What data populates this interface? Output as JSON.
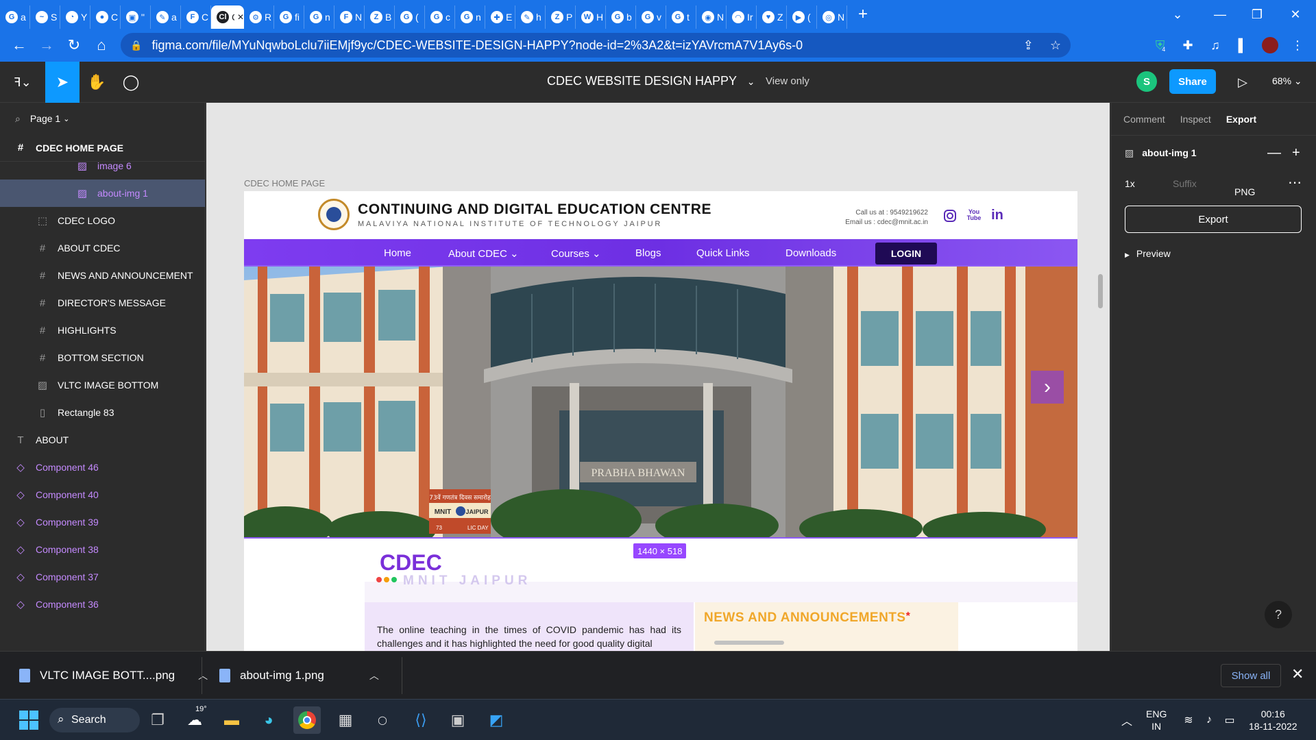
{
  "browser": {
    "tabs": [
      {
        "icon": "G",
        "text": "a"
      },
      {
        "icon": "~",
        "text": "S"
      },
      {
        "icon": "◔",
        "text": "Y"
      },
      {
        "icon": "●",
        "text": "C"
      },
      {
        "icon": "▣",
        "text": "\""
      },
      {
        "icon": "✎",
        "text": "a"
      },
      {
        "icon": "F",
        "text": "C"
      },
      {
        "icon": "Cl",
        "text": "Cl",
        "active": true
      },
      {
        "icon": "⚙",
        "text": "R"
      },
      {
        "icon": "G",
        "text": "fi"
      },
      {
        "icon": "G",
        "text": "n"
      },
      {
        "icon": "F",
        "text": "N"
      },
      {
        "icon": "Z",
        "text": "B"
      },
      {
        "icon": "G",
        "text": "("
      },
      {
        "icon": "G",
        "text": "c"
      },
      {
        "icon": "G",
        "text": "n"
      },
      {
        "icon": "✚",
        "text": "E"
      },
      {
        "icon": "✎",
        "text": "h"
      },
      {
        "icon": "Z",
        "text": "P"
      },
      {
        "icon": "W",
        "text": "H"
      },
      {
        "icon": "G",
        "text": "b"
      },
      {
        "icon": "G",
        "text": "v"
      },
      {
        "icon": "G",
        "text": "t"
      },
      {
        "icon": "◉",
        "text": "N"
      },
      {
        "icon": "◠",
        "text": "Ir"
      },
      {
        "icon": "♥",
        "text": "Z"
      },
      {
        "icon": "▶",
        "text": "("
      },
      {
        "icon": "◎",
        "text": "N"
      }
    ],
    "url": "figma.com/file/MYuNqwboLclu7iiEMjf9yc/CDEC-WEBSITE-DESIGN-HAPPY?node-id=2%3A2&t=izYAVrcmA7V1Ay6s-0",
    "extension_badge": "4"
  },
  "figma": {
    "file_title": "CDEC WEBSITE DESIGN HAPPY",
    "view_mode": "View only",
    "avatar_initial": "S",
    "share_label": "Share",
    "zoom": "68%",
    "page_name": "Page 1",
    "frame_name": "CDEC HOME PAGE",
    "layers": [
      {
        "name": "image 6",
        "kind": "img",
        "indent": 2
      },
      {
        "name": "about-img 1",
        "kind": "img",
        "indent": 2,
        "selected": true
      },
      {
        "name": "CDEC LOGO",
        "kind": "group",
        "indent": 1
      },
      {
        "name": "ABOUT CDEC",
        "kind": "frame",
        "indent": 1
      },
      {
        "name": "NEWS AND ANNOUNCEMENT",
        "kind": "frame",
        "indent": 1
      },
      {
        "name": "DIRECTOR'S MESSAGE",
        "kind": "frame",
        "indent": 1
      },
      {
        "name": "HIGHLIGHTS",
        "kind": "frame",
        "indent": 1
      },
      {
        "name": "BOTTOM SECTION",
        "kind": "frame",
        "indent": 1
      },
      {
        "name": "VLTC IMAGE BOTTOM",
        "kind": "image",
        "indent": 1
      },
      {
        "name": "Rectangle 83",
        "kind": "rect",
        "indent": 1
      },
      {
        "name": "ABOUT",
        "kind": "text",
        "indent": 0
      },
      {
        "name": "Component 46",
        "kind": "comp",
        "indent": 0
      },
      {
        "name": "Component 40",
        "kind": "comp",
        "indent": 0
      },
      {
        "name": "Component 39",
        "kind": "comp",
        "indent": 0
      },
      {
        "name": "Component 38",
        "kind": "comp",
        "indent": 0
      },
      {
        "name": "Component 37",
        "kind": "comp",
        "indent": 0
      },
      {
        "name": "Component 36",
        "kind": "comp",
        "indent": 0
      }
    ],
    "right_tabs": {
      "comment": "Comment",
      "inspect": "Inspect",
      "export": "Export"
    },
    "selection_name": "about-img 1",
    "export_scale": "1x",
    "export_suffix_placeholder": "Suffix",
    "export_format": "PNG",
    "export_button": "Export",
    "preview_label": "Preview",
    "dimension_badge": "1440 × 518",
    "help": "?"
  },
  "site": {
    "frame_label": "CDEC HOME PAGE",
    "name": "CONTINUING AND DIGITAL EDUCATION CENTRE",
    "subname": "MALAVIYA NATIONAL INSTITUTE OF TECHNOLOGY JAIPUR",
    "call": "Call us at : 9549219622",
    "email": "Email us : cdec@mnit.ac.in",
    "nav": {
      "home": "Home",
      "about": "About CDEC ⌄",
      "courses": "Courses ⌄",
      "blogs": "Blogs",
      "quick_links": "Quick Links",
      "downloads": "Downloads",
      "login": "LOGIN"
    },
    "hero": {
      "building_sign": "PRABHA BHAWAN",
      "banner_line1": "73वें गणतंत्र दिवस समारोह",
      "banner_mnit": "MNIT",
      "banner_jaipur": "JAIPUR",
      "banner_line3": "73",
      "banner_line3b": "LIC DAY"
    },
    "about_title": "CDEC",
    "about_sub": "MNIT JAIPUR",
    "about_text": "The online teaching in the times of COVID pandemic has had its challenges and it has highlighted the need for good quality digital",
    "news_title": "NEWS AND ANNOUNCEMENTS",
    "news_star": "*"
  },
  "downloads": {
    "item1": "VLTC IMAGE BOTT....png",
    "item2": "about-img 1.png",
    "show_all": "Show all"
  },
  "taskbar": {
    "search": "Search",
    "temperature": "19°",
    "lang_top": "ENG",
    "lang_bottom": "IN",
    "time": "00:16",
    "date": "18-11-2022"
  },
  "colors": {
    "chrome_blue": "#1a73e8",
    "figma_bg": "#2c2c2c",
    "figma_accent": "#0d99ff",
    "nav_purple": "#7e3cf0",
    "login_dark": "#1f0a55",
    "cdec_purple": "#7a2fd9",
    "news_orange": "#f0a72a"
  }
}
